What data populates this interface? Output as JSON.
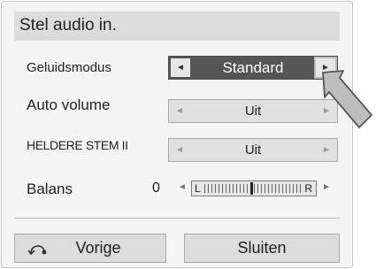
{
  "dialog": {
    "title": "Stel audio in."
  },
  "settings": [
    {
      "label": "Geluidsmodus",
      "value": "Standard",
      "left_arrow": "◄",
      "right_arrow": "►"
    },
    {
      "label": "Auto volume",
      "value": "Uit",
      "left_arrow": "◄",
      "right_arrow": "►"
    },
    {
      "label": "HELDERE STEM II",
      "value": "Uit",
      "left_arrow": "◄",
      "right_arrow": "►"
    }
  ],
  "balance": {
    "label": "Balans",
    "value": "0",
    "left_marker": "L",
    "right_marker": "R",
    "left_arrow": "◄",
    "right_arrow": "►",
    "level": 0
  },
  "buttons": {
    "back_label": "Vorige",
    "close_label": "Sluiten"
  },
  "icons": {
    "back": "back-arrow-icon",
    "pointer": "pointer-cursor-icon"
  },
  "colors": {
    "active_selector": "#555555",
    "panel": "#f4f4f4",
    "button": "#dcdcdc"
  }
}
